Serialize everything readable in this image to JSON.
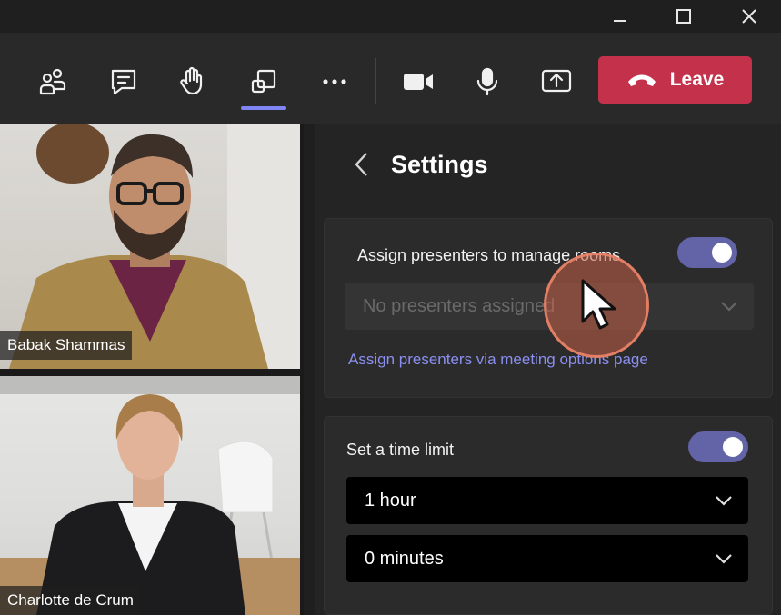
{
  "window": {
    "minimize_icon": "minimize-icon",
    "maximize_icon": "maximize-icon",
    "close_icon": "close-icon"
  },
  "toolbar": {
    "buttons": [
      {
        "name": "people",
        "icon": "people-icon"
      },
      {
        "name": "chat",
        "icon": "chat-icon"
      },
      {
        "name": "raise-hand",
        "icon": "raise-hand-icon"
      },
      {
        "name": "breakout-rooms",
        "icon": "breakout-rooms-icon",
        "active": true
      },
      {
        "name": "more",
        "icon": "more-options-icon"
      },
      {
        "name": "camera",
        "icon": "camera-icon"
      },
      {
        "name": "mic",
        "icon": "microphone-icon"
      },
      {
        "name": "share",
        "icon": "share-screen-icon"
      }
    ],
    "leave_label": "Leave",
    "accent_color": "#7f85f5",
    "leave_color": "#c4314b"
  },
  "participants": [
    {
      "name": "Babak Shammas"
    },
    {
      "name": "Charlotte de Crum"
    }
  ],
  "settings": {
    "title": "Settings",
    "assign_presenters_label": "Assign presenters to manage rooms",
    "assign_presenters_enabled": true,
    "presenters_placeholder": "No presenters assigned",
    "assign_link": "Assign presenters via meeting options page",
    "time_limit_label": "Set a time limit",
    "time_limit_enabled": true,
    "hours_value": "1 hour",
    "minutes_value": "0 minutes",
    "toggle_color": "#6264a7"
  }
}
